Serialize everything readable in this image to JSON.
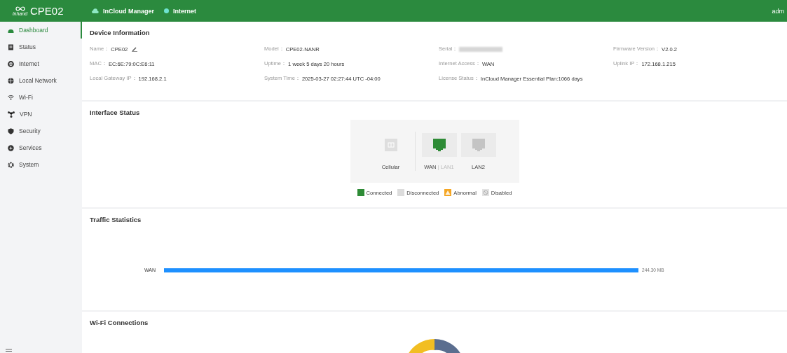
{
  "topbar": {
    "brand": "inhand",
    "title": "CPE02",
    "statuses": [
      {
        "label": "InCloud Manager",
        "kind": "cloud"
      },
      {
        "label": "Internet",
        "kind": "dot"
      }
    ],
    "user": "adm"
  },
  "sidebar": {
    "items": [
      {
        "label": "Dashboard",
        "selected": true
      },
      {
        "label": "Status",
        "selected": false
      },
      {
        "label": "Internet",
        "selected": false
      },
      {
        "label": "Local Network",
        "selected": false
      },
      {
        "label": "Wi-Fi",
        "selected": false
      },
      {
        "label": "VPN",
        "selected": false
      },
      {
        "label": "Security",
        "selected": false
      },
      {
        "label": "Services",
        "selected": false
      },
      {
        "label": "System",
        "selected": false
      }
    ]
  },
  "device_information": {
    "title": "Device Information",
    "fields": [
      {
        "label": "Name：",
        "value": "CPE02",
        "editable": true
      },
      {
        "label": "Model：",
        "value": "CPE02-NANR"
      },
      {
        "label": "Serial：",
        "redacted": true
      },
      {
        "label": "Firmware Version：",
        "value": "V2.0.2"
      },
      {
        "label": "MAC：",
        "value": "EC:6E:79:0C:E6:11"
      },
      {
        "label": "Uptime：",
        "value": "1 week 5 days 20 hours"
      },
      {
        "label": "Internet Access：",
        "value": "WAN"
      },
      {
        "label": "Uplink IP：",
        "value": "172.168.1.215"
      },
      {
        "label": "Local Gateway IP：",
        "value": "192.168.2.1"
      },
      {
        "label": "System Time：",
        "value": "2025-03-27 02:27:44 UTC -04:00"
      },
      {
        "label": "License Status：",
        "value": "InCloud Manager Essential Plan:1066 days"
      }
    ]
  },
  "interface_status": {
    "title": "Interface Status",
    "ports": [
      {
        "label": "Cellular",
        "kind": "cellular",
        "connected": false,
        "disabled": true
      },
      {
        "label": "WAN",
        "alt_label": "| LAN1",
        "kind": "ethernet",
        "connected": true,
        "disabled": false
      },
      {
        "label": "LAN2",
        "kind": "ethernet",
        "connected": false,
        "disabled": false
      }
    ],
    "legend": [
      {
        "label": "Connected",
        "kind": "swatch",
        "color": "#2e8b36"
      },
      {
        "label": "Disconnected",
        "kind": "swatch",
        "color": "#dcdcdc"
      },
      {
        "label": "Abnormal",
        "kind": "warning",
        "color": "#f5a623"
      },
      {
        "label": "Disabled",
        "kind": "disabled",
        "color": "#e3e3e3"
      }
    ]
  },
  "traffic_statistics": {
    "title": "Traffic Statistics",
    "rows": [
      {
        "name": "WAN",
        "level": 1.0,
        "reading": "244.30 MB"
      }
    ]
  },
  "wifi_connections": {
    "title": "Wi-Fi Connections"
  }
}
